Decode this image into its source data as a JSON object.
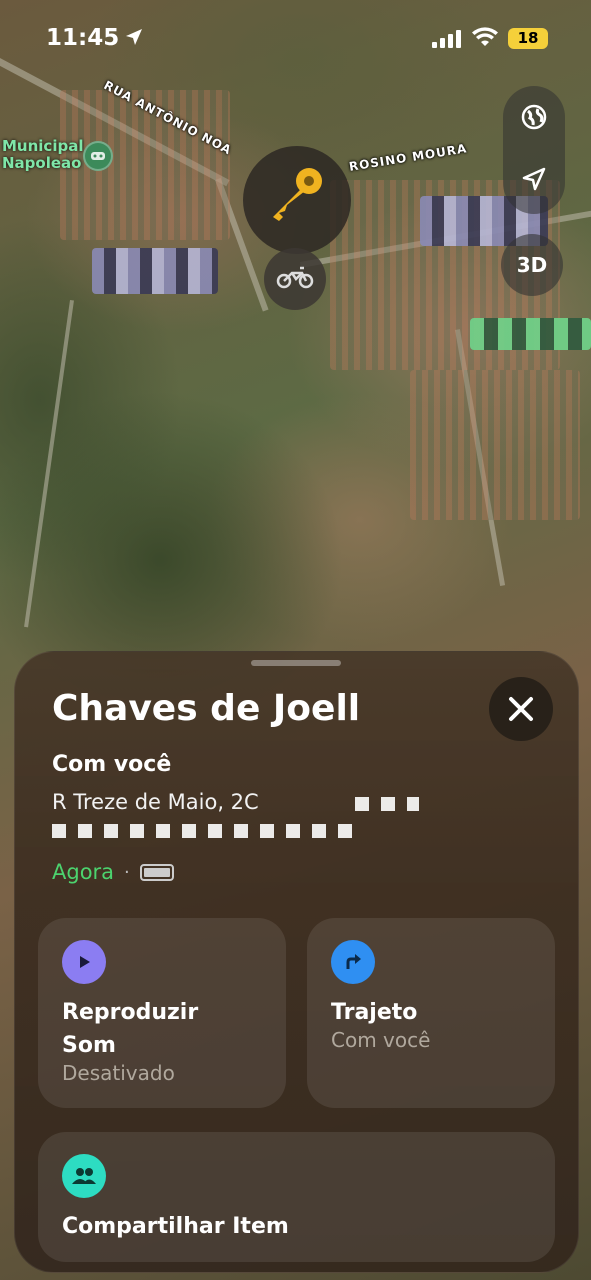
{
  "status_bar": {
    "time": "11:45",
    "battery": "18"
  },
  "map": {
    "streets": [
      "RUA ANTÔNIO NOA",
      "ROSINO MOURA"
    ],
    "poi": {
      "name": "Municipal\nNapoleao"
    },
    "controls": {
      "btn_3d": "3D"
    }
  },
  "sheet": {
    "title": "Chaves de Joell",
    "subtitle": "Com você",
    "address_line1": "R  Treze de Maio, 2C",
    "status_time": "Agora",
    "status_sep": "·",
    "cards": {
      "play_sound": {
        "title": "Reproduzir\nSom",
        "sub": "Desativado"
      },
      "directions": {
        "title": "Trajeto",
        "sub": "Com você"
      },
      "share": {
        "title": "Compartilhar Item"
      }
    },
    "colors": {
      "green": "#4cd36e",
      "play": "#8b7df2",
      "directions": "#2f8ff2",
      "share": "#2ddcc2"
    }
  }
}
